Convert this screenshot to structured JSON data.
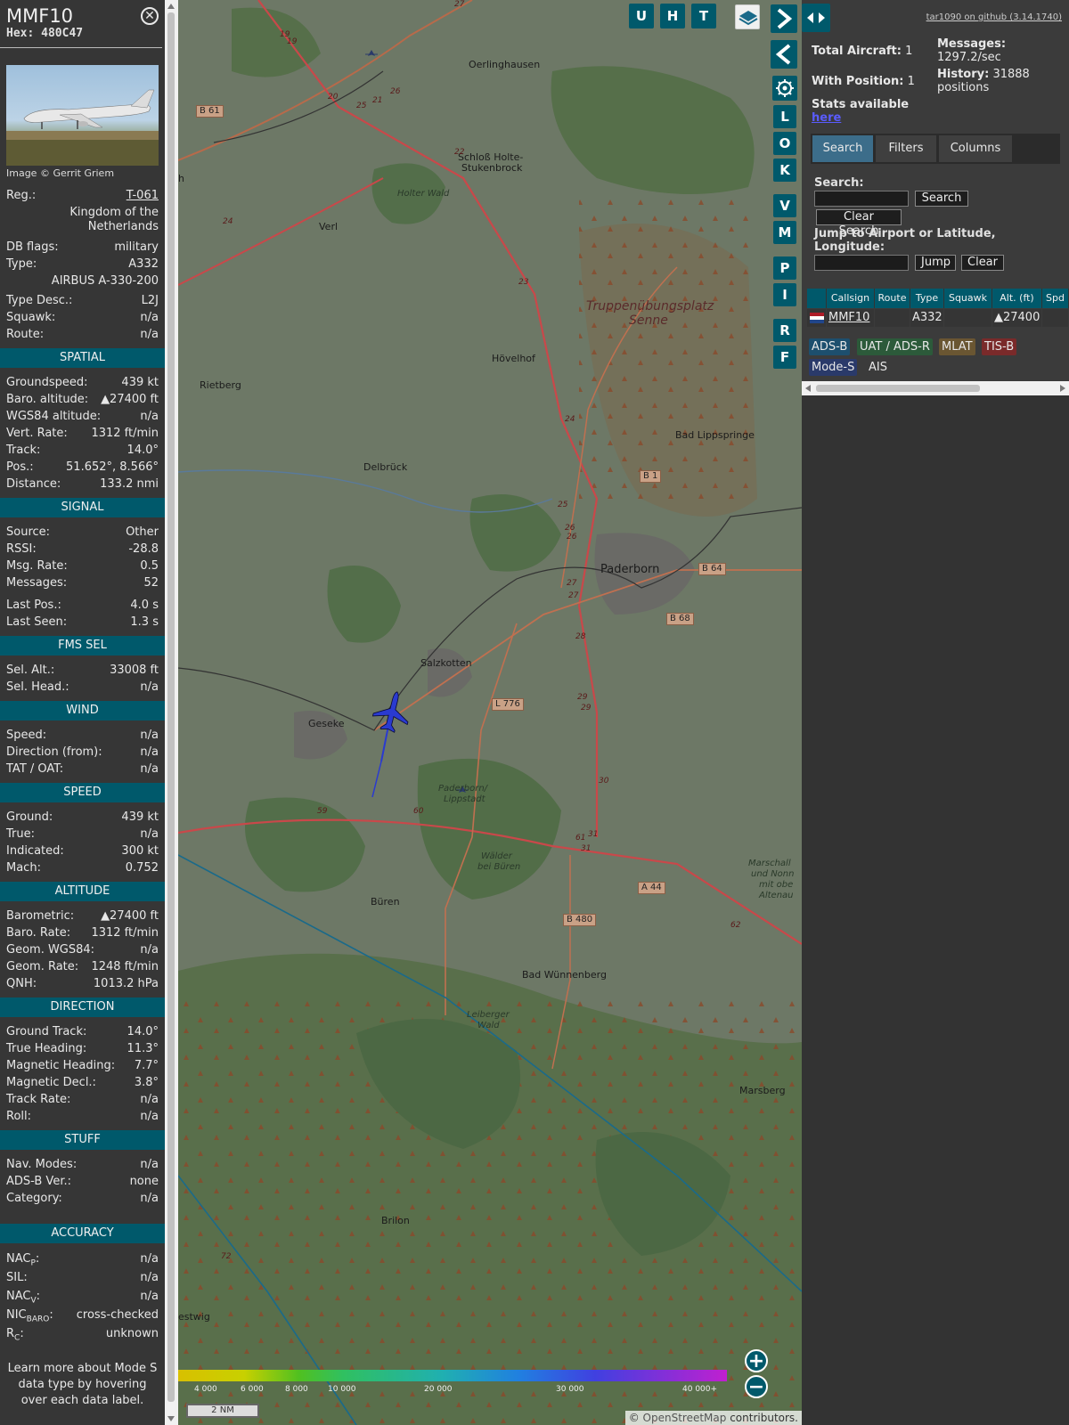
{
  "info": {
    "callsign": "MMF10",
    "hex_label": "Hex:",
    "hex": "480C47",
    "close_glyph": "✕",
    "photo_credit": "Image © Gerrit Griem",
    "rows_top": [
      {
        "label": "Reg.:",
        "value": "T-061"
      },
      {
        "label": "",
        "value": "Kingdom of the Netherlands"
      },
      {
        "label": "DB flags:",
        "value": "military"
      },
      {
        "label": "Type:",
        "value": "A332"
      },
      {
        "label": "",
        "value": "AIRBUS A-330-200"
      },
      {
        "label": "Type Desc.:",
        "value": "L2J"
      },
      {
        "label": "Squawk:",
        "value": "n/a"
      },
      {
        "label": "Route:",
        "value": "n/a"
      }
    ],
    "sections": [
      {
        "title": "SPATIAL",
        "rows": [
          {
            "label": "Groundspeed:",
            "value": "439 kt"
          },
          {
            "label": "Baro. altitude:",
            "value": "▲27400 ft"
          },
          {
            "label": "WGS84 altitude:",
            "value": "n/a"
          },
          {
            "label": "Vert. Rate:",
            "value": "1312 ft/min"
          },
          {
            "label": "Track:",
            "value": "14.0°"
          },
          {
            "label": "Pos.:",
            "value": "51.652°, 8.566°"
          },
          {
            "label": "Distance:",
            "value": "133.2 nmi"
          }
        ]
      },
      {
        "title": "SIGNAL",
        "rows": [
          {
            "label": "Source:",
            "value": "Other"
          },
          {
            "label": "RSSI:",
            "value": "-28.8"
          },
          {
            "label": "Msg. Rate:",
            "value": "0.5"
          },
          {
            "label": "Messages:",
            "value": "52"
          },
          {
            "label": "Last Pos.:",
            "value": "4.0 s"
          },
          {
            "label": "Last Seen:",
            "value": "1.3 s"
          }
        ]
      },
      {
        "title": "FMS SEL",
        "rows": [
          {
            "label": "Sel. Alt.:",
            "value": "33008 ft"
          },
          {
            "label": "Sel. Head.:",
            "value": "n/a"
          }
        ]
      },
      {
        "title": "WIND",
        "rows": [
          {
            "label": "Speed:",
            "value": "n/a"
          },
          {
            "label": "Direction (from):",
            "value": "n/a"
          },
          {
            "label": "TAT / OAT:",
            "value": "n/a"
          }
        ]
      },
      {
        "title": "SPEED",
        "rows": [
          {
            "label": "Ground:",
            "value": "439 kt"
          },
          {
            "label": "True:",
            "value": "n/a"
          },
          {
            "label": "Indicated:",
            "value": "300 kt"
          },
          {
            "label": "Mach:",
            "value": "0.752"
          }
        ]
      },
      {
        "title": "ALTITUDE",
        "rows": [
          {
            "label": "Barometric:",
            "value": "▲27400 ft"
          },
          {
            "label": "Baro. Rate:",
            "value": "1312 ft/min"
          },
          {
            "label": "Geom. WGS84:",
            "value": "n/a"
          },
          {
            "label": "Geom. Rate:",
            "value": "1248 ft/min"
          },
          {
            "label": "QNH:",
            "value": "1013.2 hPa"
          }
        ]
      },
      {
        "title": "DIRECTION",
        "rows": [
          {
            "label": "Ground Track:",
            "value": "14.0°"
          },
          {
            "label": "True Heading:",
            "value": "11.3°"
          },
          {
            "label": "Magnetic Heading:",
            "value": "7.7°"
          },
          {
            "label": "Magnetic Decl.:",
            "value": "3.8°"
          },
          {
            "label": "Track Rate:",
            "value": "n/a"
          },
          {
            "label": "Roll:",
            "value": "n/a"
          }
        ]
      },
      {
        "title": "STUFF",
        "rows": [
          {
            "label": "Nav. Modes:",
            "value": "n/a"
          },
          {
            "label": "ADS-B Ver.:",
            "value": "none"
          },
          {
            "label": "Category:",
            "value": "n/a"
          }
        ]
      }
    ],
    "accuracy_title": "ACCURACY",
    "accuracy_rows": [
      {
        "label": "NAC",
        "sub": "P",
        "suffix": ":",
        "value": "n/a"
      },
      {
        "label": "SIL:",
        "sub": "",
        "suffix": "",
        "value": "n/a"
      },
      {
        "label": "NAC",
        "sub": "V",
        "suffix": ":",
        "value": "n/a"
      },
      {
        "label": "NIC",
        "sub": "BARO",
        "suffix": ":",
        "value": "cross-checked"
      },
      {
        "label": "R",
        "sub": "C",
        "suffix": ":",
        "value": "unknown"
      }
    ],
    "footer": "Learn more about Mode S data type by hovering over each data label."
  },
  "map": {
    "buttons_top": [
      "U",
      "H",
      "T"
    ],
    "buttons_side": [
      "L",
      "O",
      "K",
      "V",
      "M",
      "P",
      "I",
      "R",
      "F"
    ],
    "zoom_in": "+",
    "zoom_out": "−",
    "scale_labels": [
      "4 000",
      "6 000",
      "8 000",
      "10 000",
      "20 000",
      "30 000",
      "40 000+"
    ],
    "scale_bar": "2 NM",
    "attribution_prefix": "© ",
    "attribution_link": "OpenStreetMap",
    "attribution_suffix": " contributors.",
    "towns": [
      {
        "name": "Oerlinghausen"
      },
      {
        "name": "Schloß Holte-"
      },
      {
        "name": "Stukenbrock"
      },
      {
        "name": "Holter Wald"
      },
      {
        "name": "Verl"
      },
      {
        "name": "Truppenübungsplatz"
      },
      {
        "name": "Senne"
      },
      {
        "name": "Hövelhof"
      },
      {
        "name": "Rietberg"
      },
      {
        "name": "Bad Lippspringe"
      },
      {
        "name": "Delbrück"
      },
      {
        "name": "Paderborn"
      },
      {
        "name": "Salzkotten"
      },
      {
        "name": "Geseke"
      },
      {
        "name": "Paderborn/"
      },
      {
        "name": "Lippstadt"
      },
      {
        "name": "Wälder"
      },
      {
        "name": "bei Büren"
      },
      {
        "name": "Büren"
      },
      {
        "name": "Bad Wünnenberg"
      },
      {
        "name": "Leiberger"
      },
      {
        "name": "Wald"
      },
      {
        "name": "Marsberg"
      },
      {
        "name": "Brilon"
      },
      {
        "name": "estwig"
      },
      {
        "name": "h"
      },
      {
        "name": "Marschall"
      },
      {
        "name": "und Nonn"
      },
      {
        "name": "mit obe"
      },
      {
        "name": "Altenau"
      }
    ],
    "road_shields": [
      "B 61",
      "B 1",
      "B 64",
      "B 68",
      "L 776",
      "A 44",
      "B 480"
    ],
    "road_numbers": [
      "27",
      "19",
      "19",
      "20",
      "25",
      "26",
      "21",
      "22",
      "24",
      "23",
      "24",
      "25",
      "26",
      "26",
      "27",
      "27",
      "28",
      "29",
      "29",
      "30",
      "31",
      "31",
      "61",
      "59",
      "60",
      "62",
      "72"
    ]
  },
  "sidebar": {
    "github": "tar1090 on github (3.14.1740)",
    "total_aircraft_label": "Total Aircraft:",
    "total_aircraft": "1",
    "with_position_label": "With Position:",
    "with_position": "1",
    "messages_label": "Messages:",
    "messages": "1297.2/sec",
    "history_label": "History:",
    "history": "31888 positions",
    "stats_label": "Stats available",
    "stats_link": "here",
    "tabs": [
      "Search",
      "Filters",
      "Columns"
    ],
    "search_label": "Search:",
    "search_button": "Search",
    "clear_search_button": "Clear Search",
    "jump_label": "Jump to Airport or Latitude, Longitude:",
    "jump_button": "Jump",
    "clear_button": "Clear",
    "table_headers": [
      "Callsign",
      "Route",
      "Type",
      "Squawk",
      "Alt. (ft)",
      "Spd"
    ],
    "table_rows": [
      {
        "callsign": "MMF10",
        "route": "",
        "type": "A332",
        "squawk": "",
        "alt": "▲27400",
        "spd": ""
      }
    ],
    "sources": [
      {
        "label": "ADS-B",
        "bg": "#1d4f6e"
      },
      {
        "label": "UAT / ADS-R",
        "bg": "#2c5a3a"
      },
      {
        "label": "MLAT",
        "bg": "#6a5632"
      },
      {
        "label": "TIS-B",
        "bg": "#7a2a2a"
      },
      {
        "label": "Mode-S",
        "bg": "#2a3a6a"
      },
      {
        "label": "AIS",
        "bg": "#3b3b3b"
      }
    ]
  }
}
